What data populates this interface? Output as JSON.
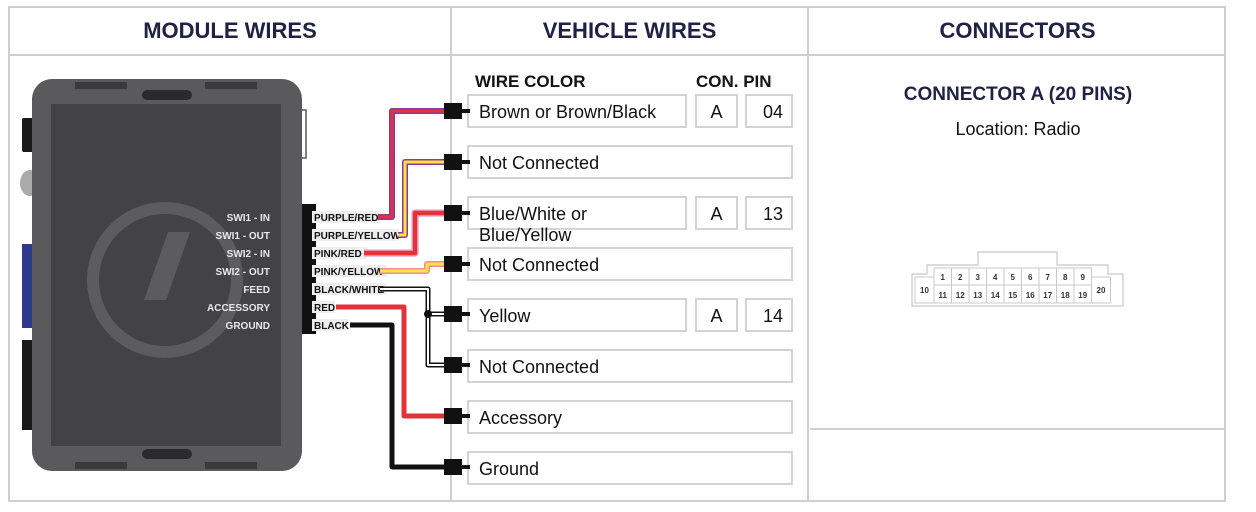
{
  "columns": {
    "module": "MODULE WIRES",
    "vehicle": "VEHICLE WIRES",
    "connectors": "CONNECTORS"
  },
  "vehicle_headers": {
    "wire_color": "WIRE COLOR",
    "con_pin": "CON. PIN"
  },
  "module": {
    "logo_icon": "i-logo-icon",
    "functions": [
      "SWI1 - IN",
      "SWI1 - OUT",
      "SWI2 - IN",
      "SWI2 - OUT",
      "FEED",
      "ACCESSORY",
      "GROUND"
    ],
    "wires": [
      "PURPLE/RED",
      "PURPLE/YELLOW",
      "PINK/RED",
      "PINK/YELLOW",
      "BLACK/WHITE",
      "RED",
      "BLACK"
    ]
  },
  "wire_colors": {
    "purple_red": {
      "core": "#e0343a",
      "stripe": "#8a3a9c"
    },
    "purple_yellow": {
      "core": "#ffe23a",
      "stripe": "#8a3a9c"
    },
    "pink_red": {
      "core": "#e0343a",
      "stripe": "#f08aa8"
    },
    "pink_yellow": {
      "core": "#ffe23a",
      "stripe": "#f08aa8"
    },
    "black_white": {
      "core": "#ffffff",
      "stripe": "#111111"
    },
    "red": {
      "core": "#e0343a"
    },
    "black": {
      "core": "#111111"
    }
  },
  "vehicle_rows": [
    {
      "wire": "Brown or Brown/Black",
      "con": "A",
      "pin": "04"
    },
    {
      "wire": "Not Connected",
      "con": null,
      "pin": null
    },
    {
      "wire": "Blue/White or Blue/Yellow",
      "con": "A",
      "pin": "13"
    },
    {
      "wire": "Not Connected",
      "con": null,
      "pin": null
    },
    {
      "wire": "Yellow",
      "con": "A",
      "pin": "14"
    },
    {
      "wire": "Not Connected",
      "con": null,
      "pin": null
    },
    {
      "wire": "Accessory",
      "con": null,
      "pin": null
    },
    {
      "wire": "Ground",
      "con": null,
      "pin": null
    }
  ],
  "connector": {
    "title": "CONNECTOR A (20 PINS)",
    "location": "Location: Radio",
    "top_pins": [
      "1",
      "2",
      "3",
      "4",
      "5",
      "6",
      "7",
      "8",
      "9"
    ],
    "bottom_pins": [
      "11",
      "12",
      "13",
      "14",
      "15",
      "16",
      "17",
      "18",
      "19"
    ],
    "left_pin": "10",
    "right_pin": "20"
  }
}
